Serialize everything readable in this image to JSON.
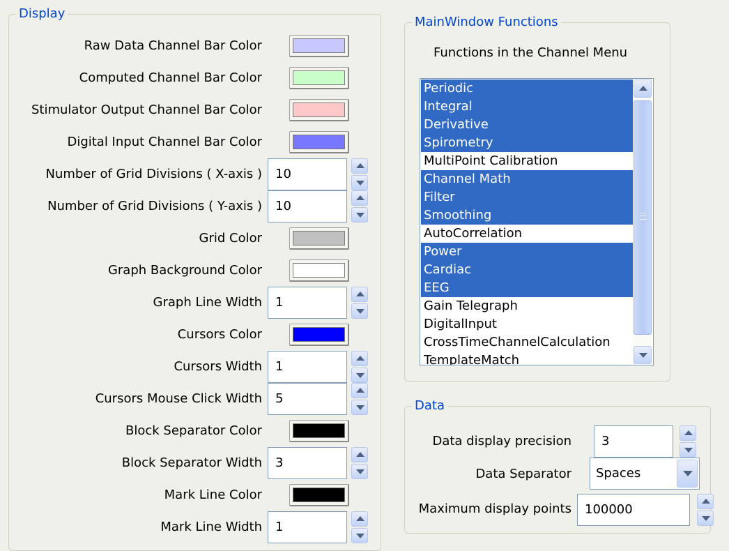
{
  "display": {
    "title": "Display",
    "rows": [
      {
        "label": "Raw Data Channel Bar Color",
        "type": "color",
        "color": "#c8c8ff"
      },
      {
        "label": "Computed Channel Bar Color",
        "type": "color",
        "color": "#c8ffc8"
      },
      {
        "label": "Stimulator Output Channel Bar Color",
        "type": "color",
        "color": "#ffc8c8"
      },
      {
        "label": "Digital Input Channel Bar Color",
        "type": "color",
        "color": "#7878ff"
      },
      {
        "label": "Number of Grid Divisions ( X-axis )",
        "type": "spin",
        "value": "10"
      },
      {
        "label": "Number of Grid Divisions ( Y-axis )",
        "type": "spin",
        "value": "10"
      },
      {
        "label": "Grid Color",
        "type": "color",
        "color": "#c0c0c0"
      },
      {
        "label": "Graph Background Color",
        "type": "color",
        "color": "#ffffff"
      },
      {
        "label": "Graph Line Width",
        "type": "spin",
        "value": "1"
      },
      {
        "label": "Cursors Color",
        "type": "color",
        "color": "#0000ff"
      },
      {
        "label": "Cursors Width",
        "type": "spin",
        "value": "1"
      },
      {
        "label": "Cursors Mouse Click Width",
        "type": "spin",
        "value": "5"
      },
      {
        "label": "Block Separator Color",
        "type": "color",
        "color": "#000000"
      },
      {
        "label": "Block Separator Width",
        "type": "spin",
        "value": "3"
      },
      {
        "label": "Mark Line Color",
        "type": "color",
        "color": "#000000"
      },
      {
        "label": "Mark Line Width",
        "type": "spin",
        "value": "1"
      }
    ]
  },
  "main_window": {
    "title": "MainWindow Functions",
    "subtitle": "Functions in the Channel Menu",
    "items": [
      {
        "label": "Periodic",
        "selected": true
      },
      {
        "label": "Integral",
        "selected": true
      },
      {
        "label": "Derivative",
        "selected": true
      },
      {
        "label": "Spirometry",
        "selected": true
      },
      {
        "label": "MultiPoint Calibration",
        "selected": false
      },
      {
        "label": "Channel Math",
        "selected": true
      },
      {
        "label": "Filter",
        "selected": true
      },
      {
        "label": "Smoothing",
        "selected": true
      },
      {
        "label": "AutoCorrelation",
        "selected": false
      },
      {
        "label": "Power",
        "selected": true
      },
      {
        "label": "Cardiac",
        "selected": true
      },
      {
        "label": "EEG",
        "selected": true
      },
      {
        "label": "Gain Telegraph",
        "selected": false
      },
      {
        "label": "DigitalInput",
        "selected": false
      },
      {
        "label": "CrossTimeChannelCalculation",
        "selected": false
      },
      {
        "label": "TemplateMatch",
        "selected": false
      }
    ]
  },
  "data_group": {
    "title": "Data",
    "precision_label": "Data display precision",
    "precision_value": "3",
    "separator_label": "Data Separator",
    "separator_value": "Spaces",
    "max_points_label": "Maximum display points",
    "max_points_value": "100000"
  }
}
